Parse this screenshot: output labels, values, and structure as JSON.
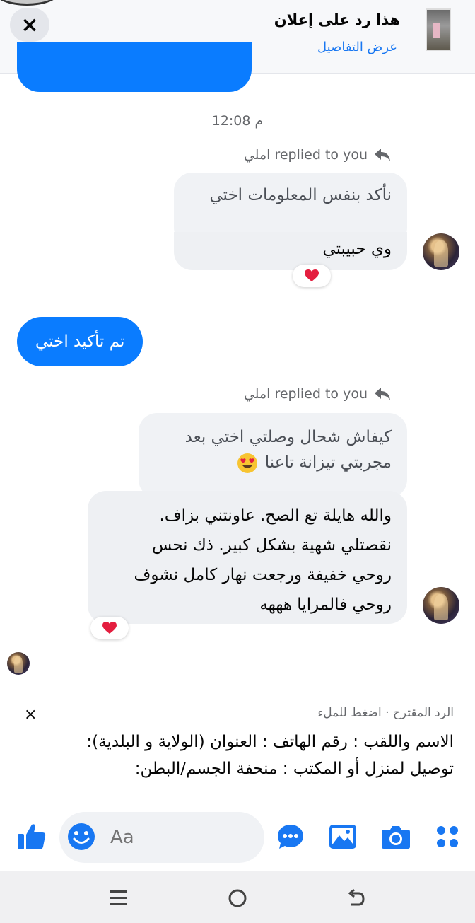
{
  "ad_banner": {
    "title": "هذا رد على إعلان",
    "details_link": "عرض التفاصيل",
    "close_icon": "close-icon"
  },
  "conversation": {
    "timestamp": "12:08 م",
    "reply_header_1": "املي replied to you",
    "quote_1": "نأكد بنفس المعلومات اختي",
    "message_1": "وي حبيبتي",
    "reaction_1": "heart",
    "outgoing_1": "تم تأكيد اختي",
    "reply_header_2": "املي replied to you",
    "quote_2_line1": "كيفاش شحال وصلتي اختي بعد",
    "quote_2_line2": "مجربتي تيزانة تاعنا",
    "quote_2_emoji": "heart-eyes-emoji",
    "message_2_lines": [
      "والله هايلة تع الصح. عاونتني بزاف.",
      "نقصتلي شهية بشكل كبير.  ذك نحس",
      "روحي خفيفة ورجعت نهار كامل نشوف",
      "روحي فالمرايا هههه"
    ],
    "reaction_2": "heart"
  },
  "suggested_reply": {
    "header": "الرد المقترح · اضغط للملء",
    "text_line1": "الاسم واللقب : رقم الهاتف : العنوان (الولاية و البلدية):",
    "text_line2": "توصيل لمنزل أو المكتب : منحفة الجسم/البطن:",
    "close": "×"
  },
  "composer": {
    "placeholder": "Aa",
    "icons": [
      "apps-icon",
      "camera-icon",
      "gallery-icon",
      "chat-bubble-icon",
      "emoji-icon",
      "like-icon"
    ]
  },
  "colors": {
    "accent": "#0a7cff",
    "icon_blue": "#1877f2",
    "incoming_bg": "#eef0f3",
    "heart": "#e41e3f"
  }
}
